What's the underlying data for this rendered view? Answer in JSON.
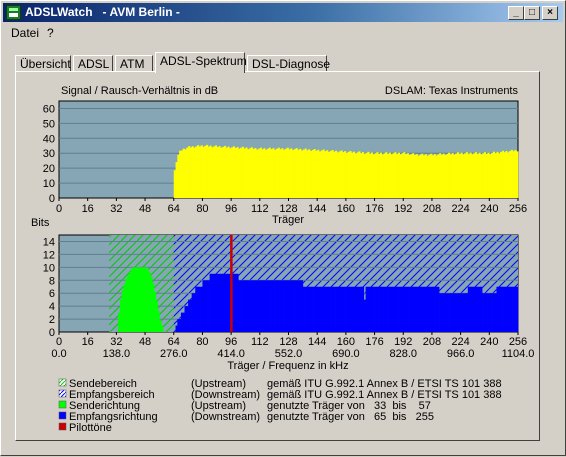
{
  "window": {
    "title": "ADSLWatch   - AVM Berlin -",
    "minimize": "_",
    "maximize": "□",
    "close": "×"
  },
  "menu": [
    "Datei",
    "?"
  ],
  "tabs": [
    "Übersicht",
    "ADSL",
    "ATM",
    "ADSL-Spektrum",
    "DSL-Diagnose"
  ],
  "active_tab": "ADSL-Spektrum",
  "colors": {
    "snr": "#ffff00",
    "chart_bg": "#86a6b5",
    "grid": "#5e7f8e",
    "downstream": "#0000ff",
    "upstream": "#00ff00",
    "pilot": "#cc0000"
  },
  "chart_data": [
    {
      "type": "bar",
      "title": "Signal / Rausch-Verhältnis in dB",
      "subtitle": "DSLAM: Texas Instruments",
      "xlabel": "Träger",
      "ylim": [
        0,
        65
      ],
      "xlim": [
        0,
        256
      ],
      "yticks": [
        0,
        10,
        20,
        30,
        40,
        50,
        60
      ],
      "xticks": [
        0,
        16,
        32,
        48,
        64,
        80,
        96,
        112,
        128,
        144,
        160,
        176,
        192,
        208,
        224,
        240,
        256
      ],
      "series": [
        {
          "carriers_from": 64,
          "carriers_to": 256,
          "x": [
            64,
            66,
            68,
            72,
            80,
            96,
            112,
            128,
            144,
            160,
            176,
            192,
            200,
            208,
            224,
            240,
            248,
            256
          ],
          "values": [
            15,
            28,
            32,
            34,
            35,
            34,
            33,
            33,
            32,
            31,
            30,
            30,
            29,
            29,
            30,
            30,
            31,
            32
          ]
        }
      ]
    },
    {
      "type": "bar",
      "ylabel": "Bits",
      "xlabel": "Träger / Frequenz in kHz",
      "ylim": [
        0,
        15
      ],
      "xlim": [
        0,
        256
      ],
      "yticks": [
        0,
        2,
        4,
        6,
        8,
        10,
        12,
        14
      ],
      "xticks": [
        0,
        16,
        32,
        48,
        64,
        80,
        96,
        112,
        128,
        144,
        160,
        176,
        192,
        208,
        224,
        240,
        256
      ],
      "freq_ticks": [
        "0.0",
        "138.0",
        "276.0",
        "414.0",
        "552.0",
        "690.0",
        "828.0",
        "966.0",
        "1104.0"
      ],
      "send_range": [
        28,
        64
      ],
      "receive_range": [
        64,
        256
      ],
      "pilot_carrier": 96,
      "series": [
        {
          "name": "Senderichtung",
          "x": [
            33,
            35,
            37,
            39,
            41,
            43,
            45,
            47,
            49,
            51,
            53,
            55,
            57
          ],
          "values": [
            2,
            6,
            8,
            9,
            10,
            10,
            10,
            10,
            10,
            9,
            7,
            4,
            1
          ]
        },
        {
          "name": "Empfangsrichtung",
          "x": [
            65,
            67,
            69,
            71,
            73,
            75,
            77,
            79,
            82,
            86,
            90,
            96,
            104,
            112,
            128,
            144,
            160,
            168,
            176,
            192,
            208,
            216,
            224,
            232,
            240,
            248,
            255
          ],
          "values": [
            1,
            2,
            3,
            4,
            5,
            6,
            7,
            7,
            8,
            9,
            9,
            9,
            8,
            8,
            8,
            7,
            7,
            7,
            7,
            7,
            7,
            6,
            6,
            7,
            6,
            7,
            7
          ]
        }
      ]
    }
  ],
  "legend": [
    {
      "label": "Sendebereich",
      "dir": "(Upstream)",
      "desc": "gemäß ITU G.992.1 Annex B / ETSI TS 101 388",
      "color": "#00ff00",
      "hatch": true
    },
    {
      "label": "Empfangsbereich",
      "dir": "(Downstream)",
      "desc": "gemäß ITU G.992.1 Annex B / ETSI TS 101 388",
      "color": "#0000ff",
      "hatch": true
    },
    {
      "label": "Senderichtung",
      "dir": "(Upstream)",
      "desc": "genutzte Träger von   33  bis    57",
      "color": "#00ff00",
      "hatch": false
    },
    {
      "label": "Empfangsrichtung",
      "dir": "(Downstream)",
      "desc": "genutzte Träger von   65  bis   255",
      "color": "#0000ff",
      "hatch": false
    },
    {
      "label": "Pilottöne",
      "dir": "",
      "desc": "",
      "color": "#cc0000",
      "hatch": false
    }
  ]
}
